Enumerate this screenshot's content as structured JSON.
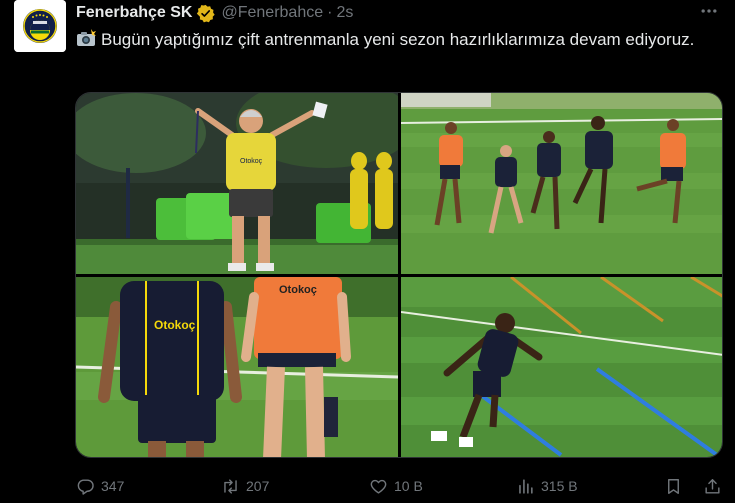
{
  "tweet": {
    "author_name": "Fenerbahçe SK",
    "handle": "@Fenerbahce",
    "separator": "·",
    "time": "2s",
    "text": "Bugün yaptığımız çift antrenmanla yeni sezon hazırlıklarımıza devam ediyoruz.",
    "emoji": "camera-flash-emoji"
  },
  "photos": [
    {
      "name": "coach-training-photo",
      "jersey_text": "Otokoç"
    },
    {
      "name": "players-running-photo"
    },
    {
      "name": "players-walking-photo",
      "jersey_text": "Otokoç",
      "bib_text": "Otokoç"
    },
    {
      "name": "player-agility-drill-photo"
    }
  ],
  "stats": {
    "replies": "347",
    "reposts": "207",
    "likes": "10 B",
    "views": "315 B"
  },
  "colors": {
    "background": "#000000",
    "text_primary": "#e7e9ea",
    "text_secondary": "#71767b",
    "verified_badge": "#e2b719",
    "border": "#2f3336",
    "club_navy": "#12204a",
    "club_yellow": "#f5d90a"
  }
}
